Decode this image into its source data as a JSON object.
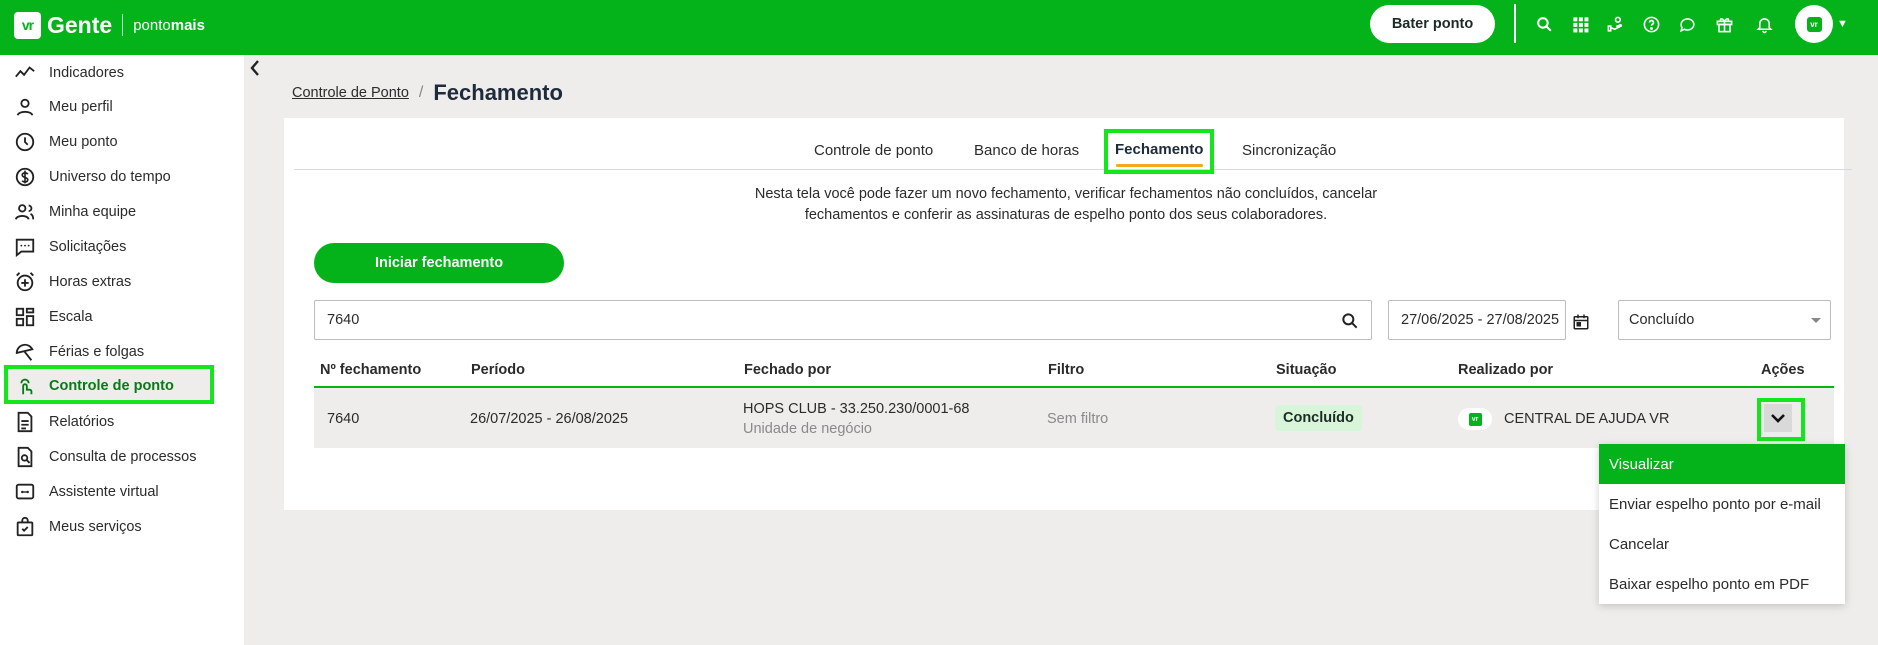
{
  "header": {
    "logo_mark": "vr",
    "logo_brand": "Gente",
    "logo_product_prefix": "ponto",
    "logo_product_suffix": "mais",
    "bater_ponto_label": "Bater ponto",
    "avatar_mark": "vr",
    "icons": [
      "search-icon",
      "apps-grid-icon",
      "benefits-icon",
      "help-icon",
      "chat-icon",
      "gift-icon",
      "bell-icon"
    ]
  },
  "sidebar": {
    "items": [
      {
        "label": "Indicadores",
        "icon": "trend-icon"
      },
      {
        "label": "Meu perfil",
        "icon": "person-icon"
      },
      {
        "label": "Meu ponto",
        "icon": "clock-icon"
      },
      {
        "label": "Universo do tempo",
        "icon": "dollar-icon"
      },
      {
        "label": "Minha equipe",
        "icon": "team-icon"
      },
      {
        "label": "Solicitações",
        "icon": "message-icon"
      },
      {
        "label": "Horas extras",
        "icon": "alarm-plus-icon"
      },
      {
        "label": "Escala",
        "icon": "grid-icon"
      },
      {
        "label": "Férias e folgas",
        "icon": "umbrella-icon"
      },
      {
        "label": "Controle de ponto",
        "icon": "touch-icon"
      },
      {
        "label": "Relatórios",
        "icon": "document-icon"
      },
      {
        "label": "Consulta de processos",
        "icon": "file-search-icon"
      },
      {
        "label": "Assistente virtual",
        "icon": "assistant-icon"
      },
      {
        "label": "Meus serviços",
        "icon": "bag-icon"
      }
    ],
    "active_index": 9
  },
  "breadcrumb": {
    "link": "Controle de Ponto",
    "separator": "/",
    "current": "Fechamento"
  },
  "tabs": [
    {
      "label": "Controle de ponto"
    },
    {
      "label": "Banco de horas"
    },
    {
      "label": "Fechamento",
      "active": true
    },
    {
      "label": "Sincronização"
    }
  ],
  "description_line1": "Nesta tela você pode fazer um novo fechamento, verificar fechamentos não concluídos, cancelar",
  "description_line2": "fechamentos e conferir as assinaturas de espelho ponto dos seus colaboradores.",
  "iniciar_label": "Iniciar fechamento",
  "filters": {
    "search_value": "7640",
    "date_range": "27/06/2025 - 27/08/2025",
    "status_selected": "Concluído"
  },
  "table": {
    "headers": [
      "Nº fechamento",
      "Período",
      "Fechado por",
      "Filtro",
      "Situação",
      "Realizado por",
      "Ações"
    ],
    "rows": [
      {
        "numero": "7640",
        "periodo": "26/07/2025 - 26/08/2025",
        "fechado_por": "HOPS CLUB - 33.250.230/0001-68",
        "fechado_por_sub": "Unidade de negócio",
        "filtro": "Sem filtro",
        "situacao": "Concluído",
        "realizado_mark": "vr",
        "realizado_por": "CENTRAL DE AJUDA VR"
      }
    ]
  },
  "actions_menu": [
    {
      "label": "Visualizar",
      "selected": true
    },
    {
      "label": "Enviar espelho ponto por e-mail"
    },
    {
      "label": "Cancelar"
    },
    {
      "label": "Baixar espelho ponto em PDF"
    }
  ],
  "colors": {
    "brand_green": "#03b319",
    "highlight_green": "#14e51d",
    "tab_underline": "#f5a623",
    "badge_bg": "#d8f5d9"
  }
}
